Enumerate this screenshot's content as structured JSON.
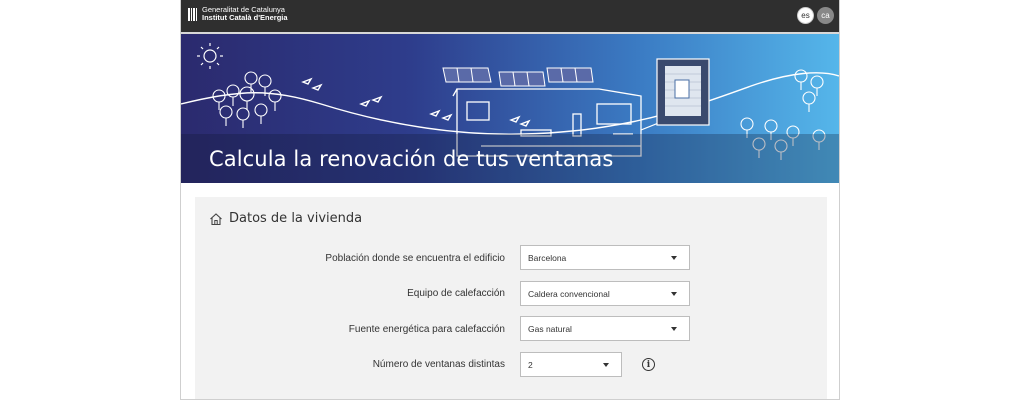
{
  "header": {
    "org_line1": "Generalitat de Catalunya",
    "org_line2": "Institut Català d'Energia",
    "languages": [
      "es",
      "ca"
    ]
  },
  "hero": {
    "title": "Calcula la renovación de tus ventanas"
  },
  "section": {
    "title": "Datos de la vivienda",
    "icon": "house-icon"
  },
  "form": {
    "fields": [
      {
        "label": "Población donde se encuentra el edificio",
        "value": "Barcelona"
      },
      {
        "label": "Equipo de calefacción",
        "value": "Caldera convencional"
      },
      {
        "label": "Fuente energética para calefacción",
        "value": "Gas natural"
      },
      {
        "label": "Número de ventanas distintas",
        "value": "2"
      }
    ]
  },
  "colors": {
    "topbar": "#2f2f2f",
    "hero_start": "#2b2a6e",
    "hero_end": "#55b6ea",
    "panel_bg": "#f2f2f2"
  }
}
